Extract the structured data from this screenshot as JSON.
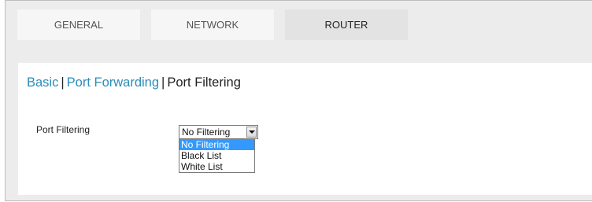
{
  "tabs": [
    {
      "label": "GENERAL",
      "active": false
    },
    {
      "label": "NETWORK",
      "active": false
    },
    {
      "label": "ROUTER",
      "active": true
    }
  ],
  "breadcrumb": {
    "items": [
      {
        "label": "Basic",
        "link": true
      },
      {
        "label": "Port Forwarding",
        "link": true
      },
      {
        "label": "Port Filtering",
        "link": false
      }
    ],
    "separator": "|"
  },
  "port_filtering": {
    "label": "Port Filtering",
    "selected_value": "No Filtering",
    "options": [
      "No Filtering",
      "Black List",
      "White List"
    ],
    "highlighted_option": "No Filtering"
  },
  "colors": {
    "link": "#2a8cb8",
    "selection": "#3399ff",
    "tab_active": "#e3e3e3",
    "tab_inactive": "#f6f6f6",
    "frame_background": "#ececec"
  }
}
